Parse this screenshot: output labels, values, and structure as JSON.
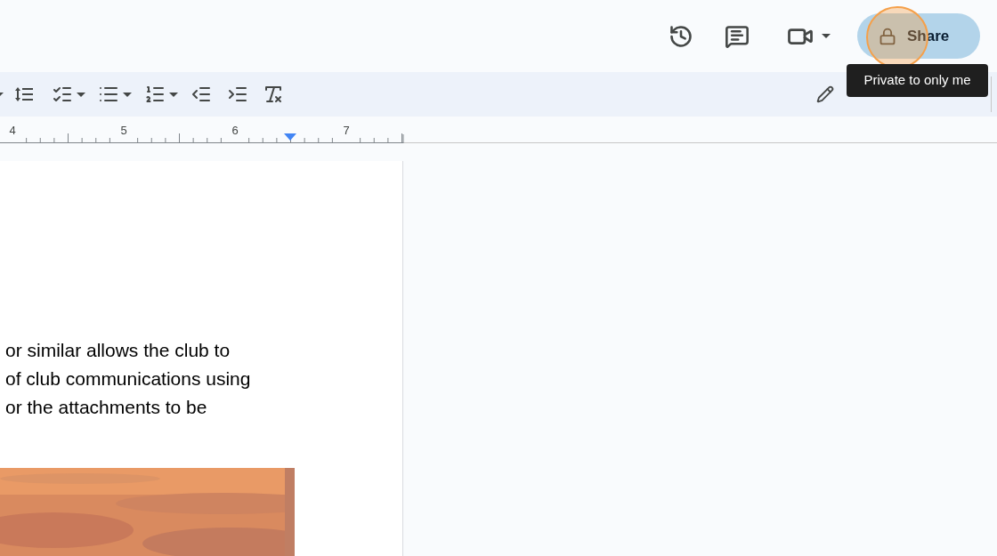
{
  "top_bar": {
    "share_button": {
      "label": "Share"
    },
    "tooltip": "Private to only me"
  },
  "ruler": {
    "labels": [
      "4",
      "5",
      "6",
      "7"
    ]
  },
  "document": {
    "lines": [
      "or similar allows the club to",
      "of club communications using",
      "or the attachments to be"
    ],
    "picture": {
      "kind": "picture"
    }
  }
}
